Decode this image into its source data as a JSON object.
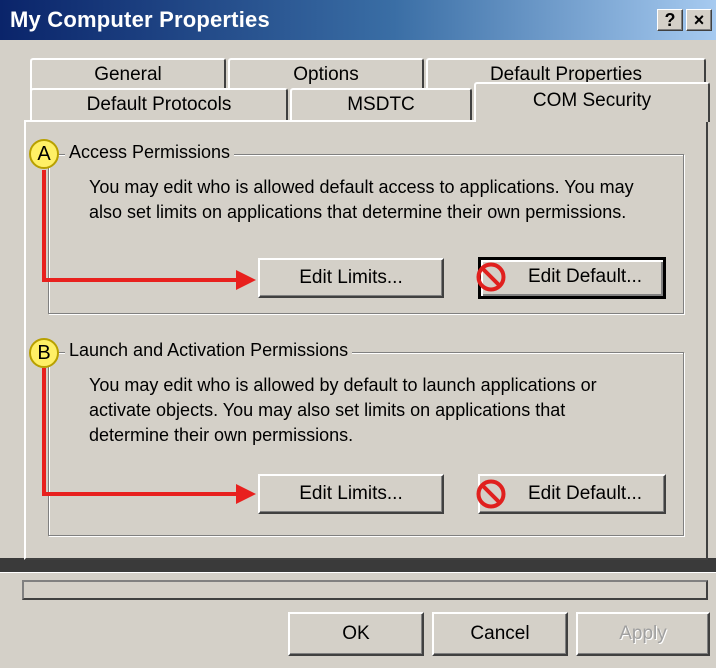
{
  "window": {
    "title": "My Computer Properties",
    "help_button": "?",
    "close_button": "×"
  },
  "tabs": {
    "row1": [
      "General",
      "Options",
      "Default Properties"
    ],
    "row2": [
      "Default Protocols",
      "MSDTC",
      "COM Security"
    ],
    "active": "COM Security"
  },
  "access_permissions": {
    "badge": "A",
    "title": "Access Permissions",
    "description_lines": [
      "You may edit who is allowed default access to applications. You may",
      "also set limits on applications that determine their own permissions."
    ],
    "edit_limits_label": "Edit Limits...",
    "edit_default_label": "Edit Default..."
  },
  "launch_permissions": {
    "badge": "B",
    "title": "Launch and Activation Permissions",
    "description_lines": [
      "You may edit who is allowed by default to launch applications or",
      "activate objects. You may also set limits on applications that",
      "determine their own permissions."
    ],
    "edit_limits_label": "Edit Limits...",
    "edit_default_label": "Edit Default..."
  },
  "footer": {
    "ok_label": "OK",
    "cancel_label": "Cancel",
    "apply_label": "Apply"
  },
  "colors": {
    "face": "#d4d0c8",
    "titlebar_start": "#0a246a",
    "annotation_arrow": "#e8201e",
    "badge_fill": "#fff066",
    "no_symbol": "#e0201e"
  },
  "icons": {
    "no_symbol": "prohibited-icon"
  }
}
